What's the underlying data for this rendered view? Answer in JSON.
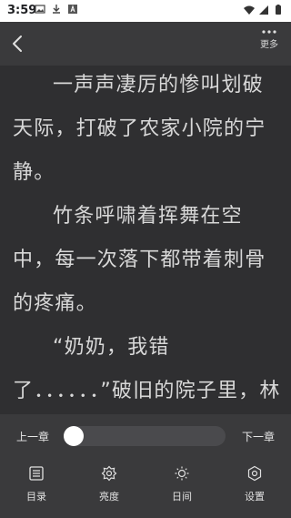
{
  "status_bar": {
    "time": "3:59",
    "left_icons": [
      "image-icon",
      "download-icon",
      "font-icon"
    ],
    "right_icons": [
      "wifi-icon",
      "signal-icon",
      "battery-icon"
    ]
  },
  "top_bar": {
    "back_icon": "chevron-left-icon",
    "more_label": "更多"
  },
  "content": {
    "paragraphs": [
      "一声声凄厉的惨叫划破天际，打破了农家小院的宁静。",
      "竹条呼啸着挥舞在空中，每一次落下都带着刺骨的疼痛。",
      "“奶奶，我错了．．．．．．”破旧的院子里，林盼儿蜷缩在地上，浑身上下没有一处完"
    ]
  },
  "chapter_nav": {
    "prev_label": "上一章",
    "next_label": "下一章",
    "progress": 0
  },
  "bottom_tabs": [
    {
      "label": "目录",
      "icon": "list-icon"
    },
    {
      "label": "亮度",
      "icon": "brightness-icon"
    },
    {
      "label": "日间",
      "icon": "sun-icon"
    },
    {
      "label": "设置",
      "icon": "settings-icon"
    }
  ],
  "colors": {
    "background": "#2f2f31",
    "panel": "#3a3a3c",
    "text": "#d8d8d8"
  }
}
